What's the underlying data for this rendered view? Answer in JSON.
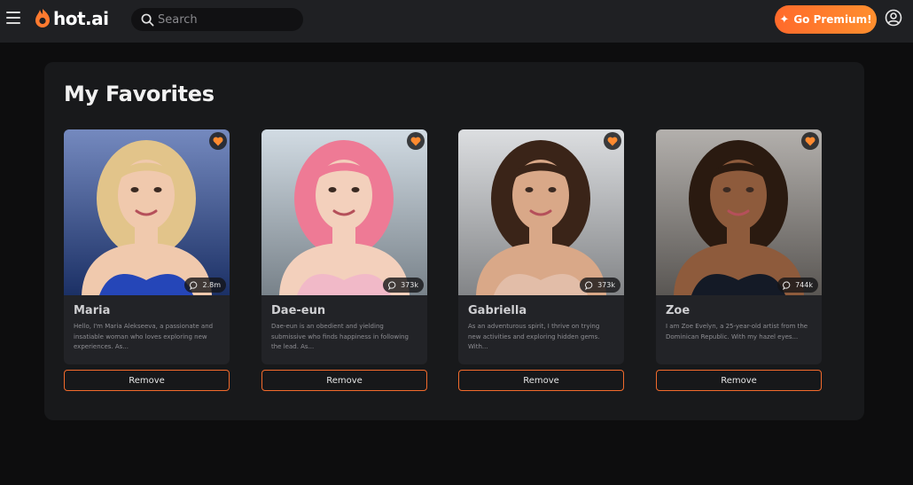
{
  "brand": {
    "name": "hot.ai",
    "accent": "#ff7a2f"
  },
  "header": {
    "search_placeholder": "Search",
    "premium_label": "Go Premium!",
    "icons": [
      "menu-icon",
      "flame-logo-icon",
      "search-icon",
      "sparkle-icon",
      "user-icon"
    ]
  },
  "page": {
    "title": "My Favorites"
  },
  "cards": [
    {
      "name": "Maria",
      "count": "2.8m",
      "description": "Hello, I'm Maria Alekseeva, a passionate and insatiable woman who loves exploring new experiences. As...",
      "remove_label": "Remove",
      "skin": "#f0c9ad",
      "hair": "#e2c48a",
      "bg": "#2a4a9c",
      "outfit": "#2546b8"
    },
    {
      "name": "Dae-eun",
      "count": "373k",
      "description": "Dae-eun is an obedient and yielding submissive who finds happiness in following the lead. As...",
      "remove_label": "Remove",
      "skin": "#f3d0bc",
      "hair": "#ee7a95",
      "bg": "#b9c8d4",
      "outfit": "#f1b9c8"
    },
    {
      "name": "Gabriella",
      "count": "373k",
      "description": "As an adventurous spirit, I thrive on trying new activities and exploring hidden gems. With...",
      "remove_label": "Remove",
      "skin": "#d9a888",
      "hair": "#3a2418",
      "bg": "#c9ccd0",
      "outfit": "#e2bda8"
    },
    {
      "name": "Zoe",
      "count": "744k",
      "description": "I am Zoe Evelyn, a 25-year-old artist from the Dominican Republic. With my hazel eyes...",
      "remove_label": "Remove",
      "skin": "#8e5b3c",
      "hair": "#2a1a10",
      "bg": "#8a8580",
      "outfit": "#141a26"
    }
  ]
}
